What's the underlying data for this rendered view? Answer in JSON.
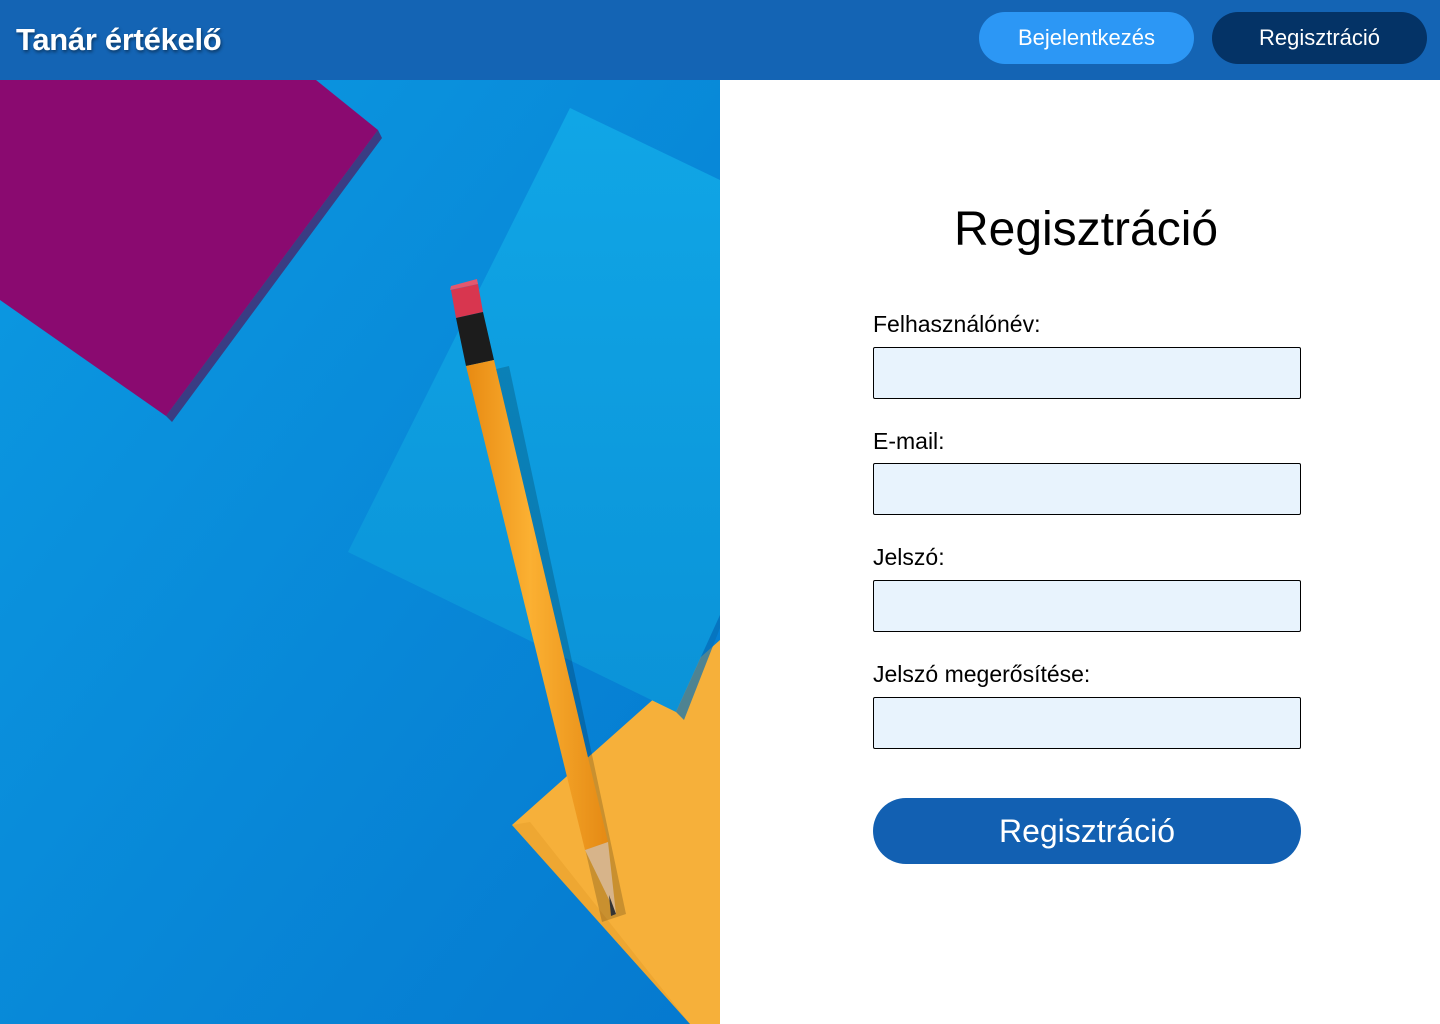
{
  "header": {
    "brand": "Tanár értékelő",
    "nav": {
      "login_label": "Bejelentkezés",
      "register_label": "Regisztráció"
    }
  },
  "hero": {
    "image": "pencil-on-colored-paper-photo"
  },
  "form": {
    "title": "Regisztráció",
    "fields": [
      {
        "label": "Felhasználónév:",
        "value": ""
      },
      {
        "label": "E-mail:",
        "value": ""
      },
      {
        "label": "Jelszó:",
        "value": ""
      },
      {
        "label": "Jelszó megerősítése:",
        "value": ""
      }
    ],
    "submit_label": "Regisztráció"
  },
  "colors": {
    "header_bg": "#1464b4",
    "login_btn": "#2c97f5",
    "register_nav_btn": "#043366",
    "submit_btn": "#1260b2",
    "input_bg": "#e8f3fd",
    "hero_blue": "#0a8fdc",
    "paper_purple": "#8a0a70",
    "paper_yellow": "#f7b23c",
    "pencil": "#f9a428"
  }
}
